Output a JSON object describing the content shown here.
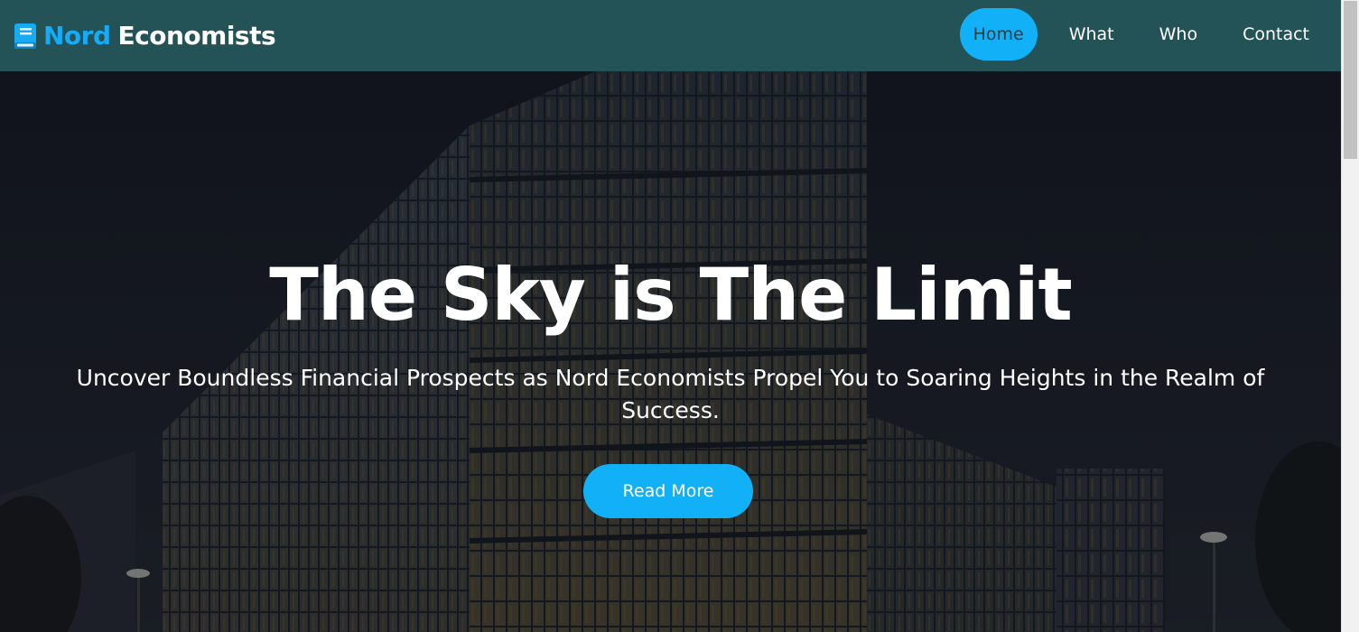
{
  "brand": {
    "icon": "book-icon",
    "name_part1": "Nord",
    "name_part2": "Economists",
    "accent_color": "#17abf5"
  },
  "nav": {
    "items": [
      {
        "label": "Home",
        "active": true
      },
      {
        "label": "What",
        "active": false
      },
      {
        "label": "Who",
        "active": false
      },
      {
        "label": "Contact",
        "active": false
      }
    ],
    "bar_color": "#235257"
  },
  "hero": {
    "title": "The Sky is The Limit",
    "subtitle": "Uncover Boundless Financial Prospects as Nord Economists Propel You to Soaring Heights in the Realm of Success.",
    "cta_label": "Read More",
    "cta_color": "#12b0f7"
  }
}
